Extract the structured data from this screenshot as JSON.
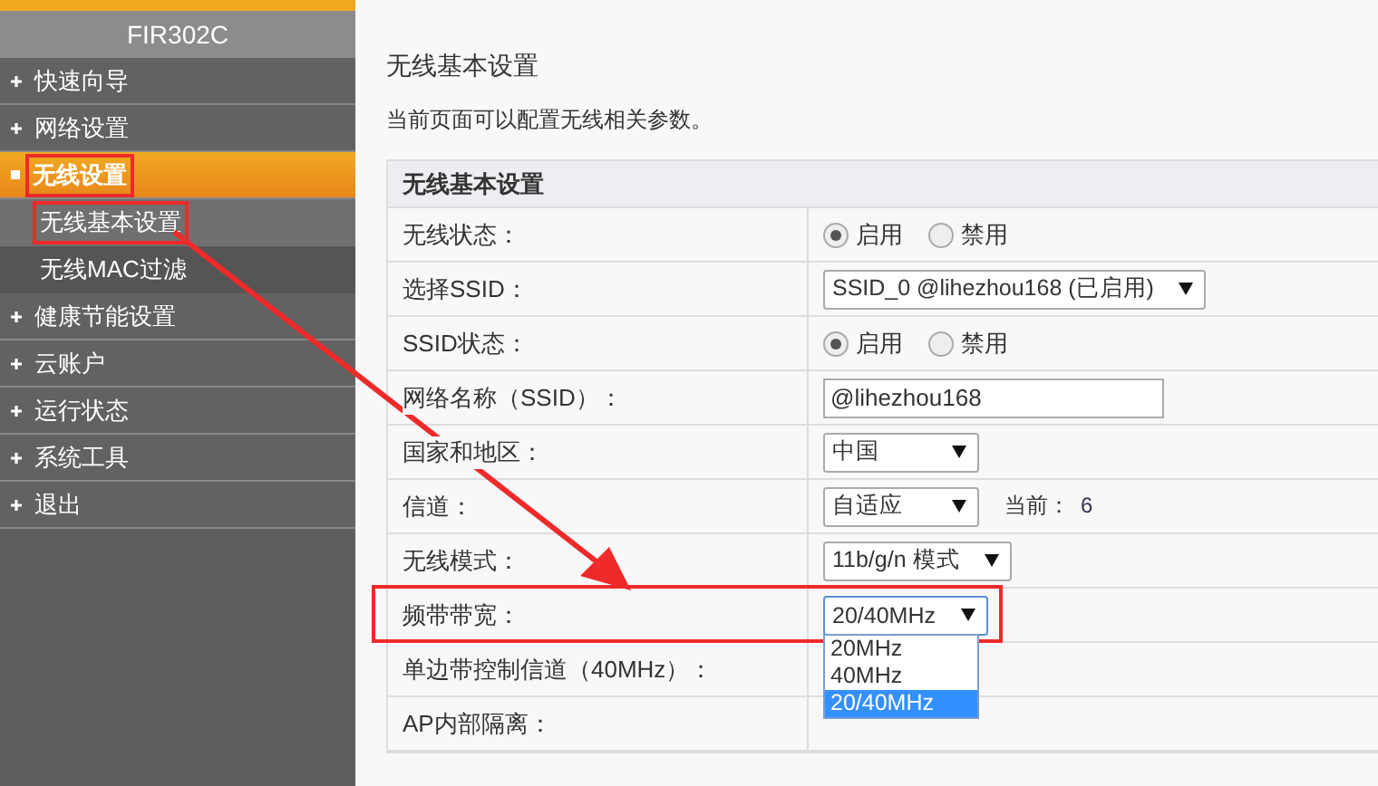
{
  "sidebar": {
    "title": "FIR302C",
    "items": [
      {
        "label": "快速向导",
        "expanded": false,
        "selected": false,
        "highlighted": false
      },
      {
        "label": "网络设置",
        "expanded": false,
        "selected": false,
        "highlighted": false
      },
      {
        "label": "无线设置",
        "expanded": true,
        "selected": true,
        "highlighted": true,
        "children": [
          {
            "label": "无线基本设置",
            "selected": true,
            "highlighted": true
          },
          {
            "label": "无线MAC过滤",
            "selected": false,
            "highlighted": false
          }
        ]
      },
      {
        "label": "健康节能设置",
        "expanded": false,
        "selected": false,
        "highlighted": false
      },
      {
        "label": "云账户",
        "expanded": false,
        "selected": false,
        "highlighted": false
      },
      {
        "label": "运行状态",
        "expanded": false,
        "selected": false,
        "highlighted": false
      },
      {
        "label": "系统工具",
        "expanded": false,
        "selected": false,
        "highlighted": false
      },
      {
        "label": "退出",
        "expanded": false,
        "selected": false,
        "highlighted": false
      }
    ]
  },
  "page": {
    "title": "无线基本设置",
    "description": "当前页面可以配置无线相关参数。"
  },
  "table": {
    "header": "无线基本设置",
    "rows": [
      {
        "label": "无线状态：",
        "kind": "radio",
        "highlighted": false,
        "options": [
          {
            "label": "启用",
            "selected": true
          },
          {
            "label": "禁用",
            "selected": false
          }
        ]
      },
      {
        "label": "选择SSID：",
        "kind": "select",
        "highlighted": false,
        "value": "SSID_0 @lihezhou168 (已启用)"
      },
      {
        "label": "SSID状态：",
        "kind": "radio",
        "highlighted": false,
        "options": [
          {
            "label": "启用",
            "selected": true
          },
          {
            "label": "禁用",
            "selected": false
          }
        ]
      },
      {
        "label": "网络名称（SSID）：",
        "kind": "input",
        "highlighted": false,
        "value": "@lihezhou168"
      },
      {
        "label": "国家和地区：",
        "kind": "select",
        "highlighted": false,
        "value": "中国"
      },
      {
        "label": "信道：",
        "kind": "select",
        "highlighted": false,
        "value": "自适应",
        "note_label": "当前：",
        "note_value": "6"
      },
      {
        "label": "无线模式：",
        "kind": "select",
        "highlighted": false,
        "value": "11b/g/n 模式"
      },
      {
        "label": "频带带宽：",
        "kind": "select",
        "highlighted": true,
        "value": "20/40MHz",
        "open": true,
        "options": [
          {
            "label": "20MHz",
            "selected": false
          },
          {
            "label": "40MHz",
            "selected": false
          },
          {
            "label": "20/40MHz",
            "selected": true
          }
        ]
      },
      {
        "label": "单边带控制信道（40MHz）：",
        "kind": "none",
        "highlighted": false
      },
      {
        "label": "AP内部隔离：",
        "kind": "none",
        "highlighted": false
      }
    ]
  }
}
